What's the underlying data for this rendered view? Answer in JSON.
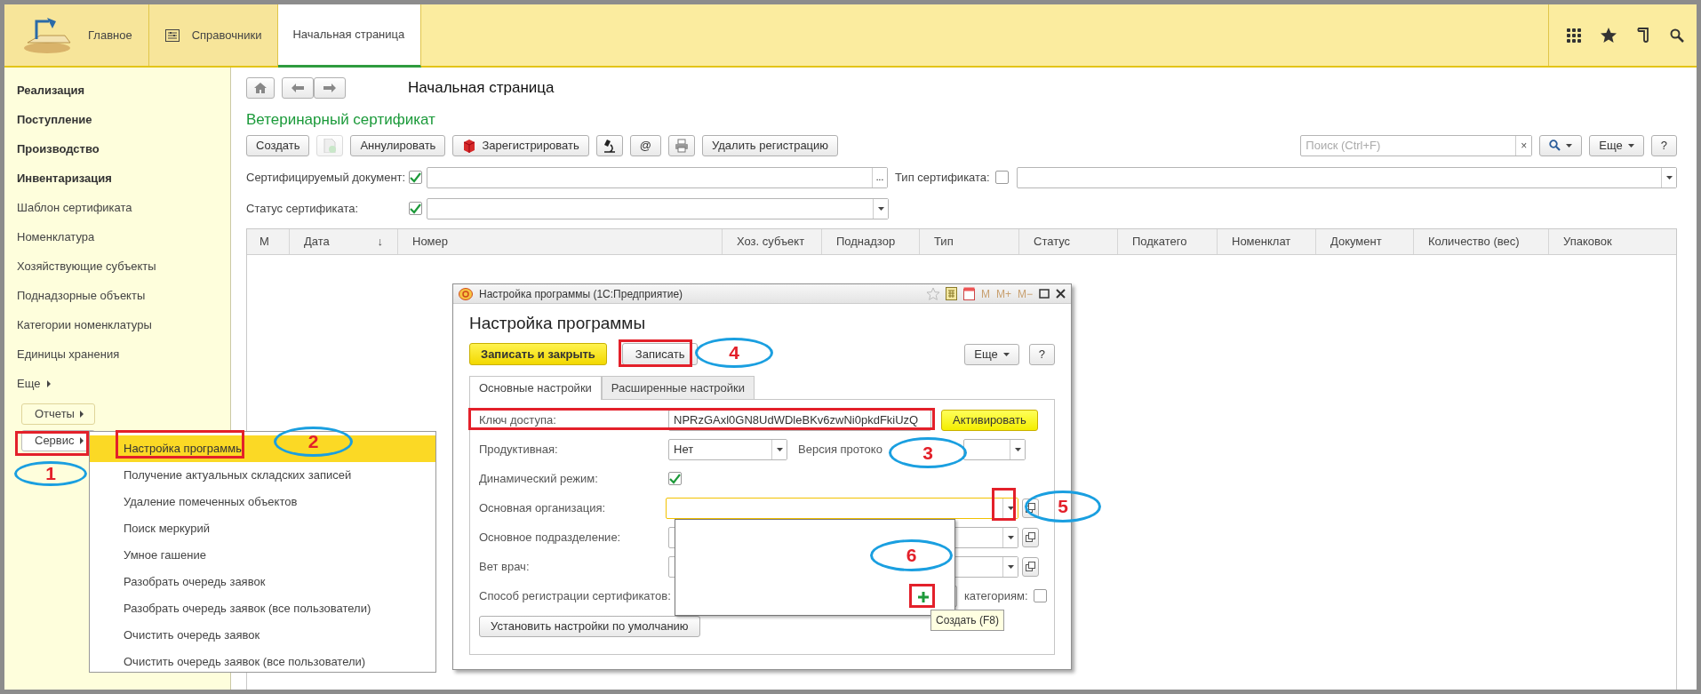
{
  "header": {
    "tabs": [
      {
        "label": "Главное",
        "selected": false,
        "kind": "home"
      },
      {
        "label": "Справочники",
        "selected": false,
        "kind": "list"
      },
      {
        "label": "Начальная страница",
        "selected": true,
        "kind": "plain"
      }
    ]
  },
  "sidebar": {
    "items": [
      {
        "label": "Реализация",
        "kind": "section"
      },
      {
        "label": "Поступление",
        "kind": "section"
      },
      {
        "label": "Производство",
        "kind": "section"
      },
      {
        "label": "Инвентаризация",
        "kind": "section"
      },
      {
        "label": "Шаблон сертификата",
        "kind": "link"
      },
      {
        "label": "Номенклатура",
        "kind": "link"
      },
      {
        "label": "Хозяйствующие субъекты",
        "kind": "link"
      },
      {
        "label": "Поднадзорные объекты",
        "kind": "link"
      },
      {
        "label": "Категории номенклатуры",
        "kind": "link"
      },
      {
        "label": "Единицы хранения",
        "kind": "link"
      }
    ],
    "more": "Еще",
    "buttons": [
      {
        "label": "Отчеты",
        "selected": false
      },
      {
        "label": "Сервис",
        "selected": true
      }
    ]
  },
  "page": {
    "title": "Начальная страница",
    "form_title": "Ветеринарный сертификат",
    "toolbar": [
      {
        "kind": "text",
        "label": "Создать",
        "disabled": false
      },
      {
        "kind": "document",
        "disabled": true
      },
      {
        "kind": "text",
        "label": "Аннулировать",
        "disabled": false
      },
      {
        "kind": "register",
        "label": "Зарегистрировать",
        "disabled": false
      },
      {
        "kind": "microscope",
        "disabled": false
      },
      {
        "kind": "text",
        "label": "@",
        "disabled": false
      },
      {
        "kind": "printer",
        "disabled": false
      },
      {
        "kind": "text",
        "label": "Удалить регистрацию",
        "disabled": false
      }
    ],
    "search": {
      "placeholder": "Поиск (Ctrl+F)",
      "clear": "×"
    },
    "more": "Еще",
    "help": "?",
    "filters": [
      {
        "label": "Сертифицируемый документ:",
        "checked": true,
        "button": "...",
        "second_label": "Тип сертификата:",
        "second_checked": false
      },
      {
        "label": "Статус сертификата:",
        "checked": true
      }
    ],
    "table": {
      "columns": [
        {
          "label": "М"
        },
        {
          "label": "Дата",
          "sort": "↓"
        },
        {
          "label": "Номер"
        },
        {
          "label": "Хоз. субъект"
        },
        {
          "label": "Поднадзор"
        },
        {
          "label": "Тип"
        },
        {
          "label": "Статус"
        },
        {
          "label": "Подкатего"
        },
        {
          "label": "Номенклат"
        },
        {
          "label": "Документ"
        },
        {
          "label": "Количество (вес)"
        },
        {
          "label": "Упаковок"
        }
      ]
    }
  },
  "service_menu": {
    "items": [
      {
        "label": "Настройка программы",
        "selected": true
      },
      {
        "label": "Получение актуальных складских записей",
        "selected": false
      },
      {
        "label": "Удаление помеченных объектов",
        "selected": false
      },
      {
        "label": "Поиск меркурий",
        "selected": false
      },
      {
        "label": "Умное гашение",
        "selected": false
      },
      {
        "label": "Разобрать очередь заявок",
        "selected": false
      },
      {
        "label": "Разобрать очередь заявок (все пользователи)",
        "selected": false
      },
      {
        "label": "Очистить очередь заявок",
        "selected": false
      },
      {
        "label": "Очистить очередь заявок (все пользователи)",
        "selected": false
      }
    ]
  },
  "dialog": {
    "window_title": "Настройка программы  (1С:Предприятие)",
    "memory_buttons": [
      "M",
      "M+",
      "M−"
    ],
    "title": "Настройка программы",
    "save_close": "Записать и закрыть",
    "save": "Записать",
    "more": "Еще",
    "help": "?",
    "tabs": [
      {
        "label": "Основные настройки",
        "selected": true
      },
      {
        "label": "Расширенные настройки",
        "selected": false
      }
    ],
    "fields": [
      {
        "kind": "key",
        "label": "Ключ доступа:",
        "value": "NPRzGAxl0GN8UdWDleBKv6zwNi0pkdFkiUzQ",
        "button": "Активировать"
      },
      {
        "kind": "select",
        "label": "Продуктивная:",
        "value": "Нет",
        "second_label": "Версия протоко"
      },
      {
        "kind": "checkbox",
        "label": "Динамический режим:",
        "checked": true
      },
      {
        "kind": "lookup",
        "label": "Основная организация:",
        "focused": true
      },
      {
        "kind": "lookup",
        "label": "Основное подразделение:",
        "focused": false
      },
      {
        "kind": "lookup",
        "label": "Вет врач:",
        "focused": false
      },
      {
        "kind": "split",
        "label": "Способ регистрации сертификатов:",
        "second_label": "категориям:",
        "checked": false
      }
    ],
    "defaults_button": "Установить настройки по умолчанию",
    "tooltip": "Создать (F8)"
  },
  "callouts": [
    {
      "label": "1"
    },
    {
      "label": "2"
    },
    {
      "label": "3"
    },
    {
      "label": "4"
    },
    {
      "label": "5"
    },
    {
      "label": "6"
    }
  ]
}
